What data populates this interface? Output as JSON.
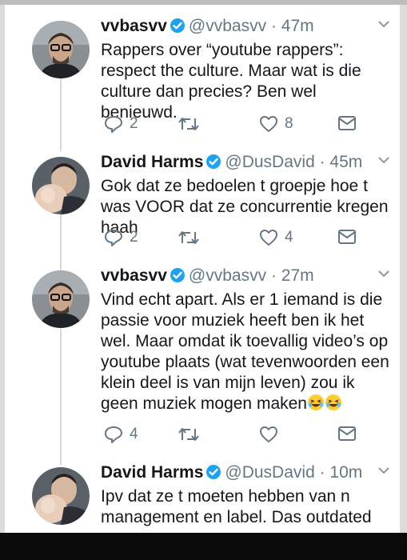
{
  "tweets": [
    {
      "name": "vvbasvv",
      "handle": "@vvbasvv",
      "time": "· 47m",
      "text": "Rappers over “youtube rappers”: respect the culture. Maar wat is die culture dan precies? Ben wel benieuwd.",
      "replies": "2",
      "retweets": "",
      "likes": "8"
    },
    {
      "name": "David Harms",
      "handle": "@DusDavid",
      "time": "· 45m",
      "text": "Gok dat ze bedoelen t groepje hoe t was VOOR dat ze concurrentie kregen haah",
      "replies": "2",
      "retweets": "",
      "likes": "4"
    },
    {
      "name": "vvbasvv",
      "handle": "@vvbasvv",
      "time": "· 27m",
      "text": "Vind echt apart. Als er 1 iemand is die passie voor muziek heeft ben ik het wel. Maar omdat ik toevallig video’s op youtube plaats (wat tevenwoorden een klein deel is van mijn leven) zou ik geen muziek mogen maken",
      "replies": "4",
      "retweets": "",
      "likes": ""
    },
    {
      "name": "David Harms",
      "handle": "@DusDavid",
      "time": "· 10m",
      "text": "Ipv dat ze t moeten hebben van n management en label. Das outdated son"
    }
  ],
  "icons": {
    "reply": "reply-icon",
    "retweet": "retweet-icon",
    "like": "heart-icon",
    "message": "envelope-icon",
    "verified": "verified-badge-icon",
    "emoji": "laughing-emoji-icon"
  },
  "colors": {
    "verified": "#1da1f2",
    "muted": "#657786",
    "text": "#14171a"
  }
}
